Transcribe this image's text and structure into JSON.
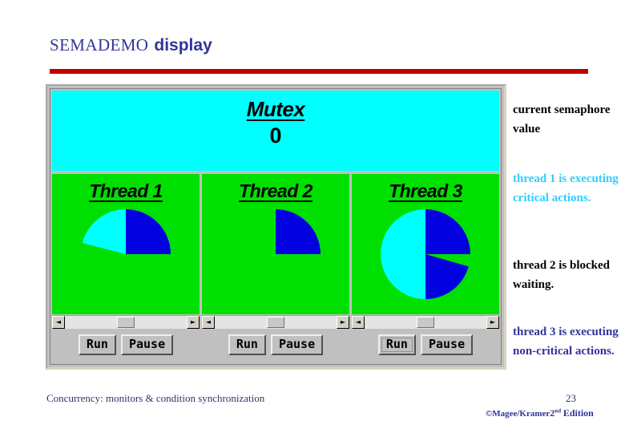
{
  "slide": {
    "title_prefix": "SEMADEMO",
    "title_suffix": "display",
    "page_number": "23",
    "footer_note": "Concurrency: monitors & condition synchronization",
    "copyright_owner": "©Magee/Kramer",
    "copyright_edition_num": "2",
    "copyright_edition_ord": "nd",
    "copyright_edition_word": "Edition",
    "rule_color": "#c00000",
    "title_color": "#333399"
  },
  "applet": {
    "background": "#c0c0c0",
    "semaphore": {
      "label": "Mutex",
      "value": "0",
      "background": "#00ffff"
    },
    "thread_panel_background": "#00e000",
    "colors": {
      "critical": "#0000e0",
      "noncritical": "#00ffff",
      "idle": "#00e000"
    },
    "threads": [
      {
        "label": "Thread 1",
        "scrollbar": {
          "left_arrow": "◄",
          "right_arrow": "►",
          "thumb_position": "center"
        },
        "buttons": [
          {
            "label": "Run",
            "focused": false
          },
          {
            "label": "Pause",
            "focused": false
          }
        ],
        "pie": {
          "shape": "partial",
          "segments": [
            {
              "color": "#0000e0",
              "start_deg": 0,
              "end_deg": 90
            },
            {
              "color": "#00ffff",
              "start_deg": 255,
              "end_deg": 360
            }
          ]
        }
      },
      {
        "label": "Thread 2",
        "scrollbar": {
          "left_arrow": "◄",
          "right_arrow": "►",
          "thumb_position": "center"
        },
        "buttons": [
          {
            "label": "Run",
            "focused": false
          },
          {
            "label": "Pause",
            "focused": false
          }
        ],
        "pie": {
          "shape": "partial",
          "segments": [
            {
              "color": "#0000e0",
              "start_deg": 0,
              "end_deg": 90
            }
          ]
        }
      },
      {
        "label": "Thread 3",
        "scrollbar": {
          "left_arrow": "◄",
          "right_arrow": "►",
          "thumb_position": "center"
        },
        "buttons": [
          {
            "label": "Run",
            "focused": true
          },
          {
            "label": "Pause",
            "focused": false
          }
        ],
        "pie": {
          "shape": "full",
          "segments": [
            {
              "color": "#0000e0",
              "start_deg": 0,
              "end_deg": 90
            },
            {
              "color": "#00e000",
              "start_deg": 90,
              "end_deg": 106
            },
            {
              "color": "#0000e0",
              "start_deg": 106,
              "end_deg": 180
            },
            {
              "color": "#00ffff",
              "start_deg": 180,
              "end_deg": 360
            }
          ]
        }
      }
    ]
  },
  "annotations": {
    "semaphore_value": "current semaphore value",
    "thread1_state": "thread 1 is executing critical actions.",
    "thread2_state": "thread 2 is blocked waiting.",
    "thread3_state": "thread 3 is executing non-critical actions."
  }
}
